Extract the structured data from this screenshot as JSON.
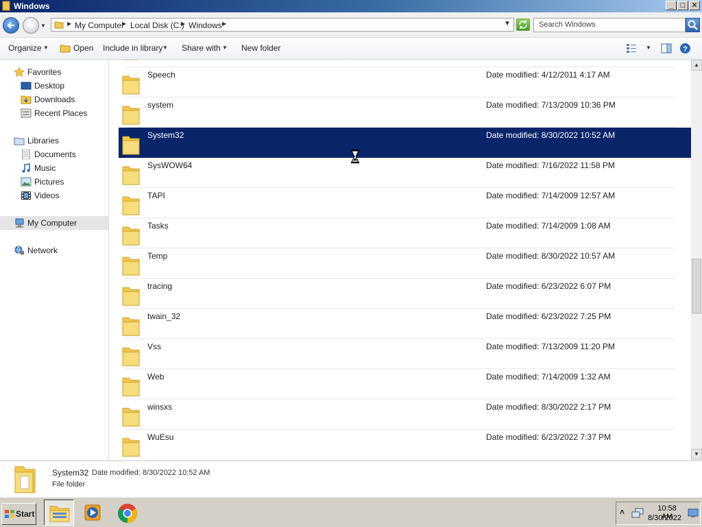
{
  "window": {
    "title": "Windows",
    "minimize": "_",
    "maximize": "□",
    "close": "✕"
  },
  "address": {
    "crumbs": [
      "My Computer",
      "Local Disk (C:)",
      "Windows"
    ],
    "search_placeholder": "Search Windows"
  },
  "toolbar": {
    "organize": "Organize",
    "open": "Open",
    "include_in_library": "Include in library",
    "share_with": "Share with",
    "new_folder": "New folder"
  },
  "sidebar": {
    "favorites": "Favorites",
    "desktop": "Desktop",
    "downloads": "Downloads",
    "recent_places": "Recent Places",
    "libraries": "Libraries",
    "documents": "Documents",
    "music": "Music",
    "pictures": "Pictures",
    "videos": "Videos",
    "my_computer": "My Computer",
    "network": "Network"
  },
  "files": [
    {
      "name": "Speech",
      "modified": "Date modified: 4/12/2011 4:17 AM"
    },
    {
      "name": "system",
      "modified": "Date modified: 7/13/2009 10:36 PM"
    },
    {
      "name": "System32",
      "modified": "Date modified: 8/30/2022 10:52 AM",
      "selected": true
    },
    {
      "name": "SysWOW64",
      "modified": "Date modified: 7/16/2022 11:58 PM"
    },
    {
      "name": "TAPI",
      "modified": "Date modified: 7/14/2009 12:57 AM"
    },
    {
      "name": "Tasks",
      "modified": "Date modified: 7/14/2009 1:08 AM"
    },
    {
      "name": "Temp",
      "modified": "Date modified: 8/30/2022 10:57 AM"
    },
    {
      "name": "tracing",
      "modified": "Date modified: 6/23/2022 6:07 PM"
    },
    {
      "name": "twain_32",
      "modified": "Date modified: 6/23/2022 7:25 PM"
    },
    {
      "name": "Vss",
      "modified": "Date modified: 7/13/2009 11:20 PM"
    },
    {
      "name": "Web",
      "modified": "Date modified: 7/14/2009 1:32 AM"
    },
    {
      "name": "winsxs",
      "modified": "Date modified: 8/30/2022 2:17 PM"
    },
    {
      "name": "WuEsu",
      "modified": "Date modified: 6/23/2022 7:37 PM"
    }
  ],
  "details": {
    "name": "System32",
    "modified_label": "Date modified: 8/30/2022 10:52 AM",
    "type": "File folder"
  },
  "taskbar": {
    "start": "Start",
    "time": "10:58 AM",
    "date": "8/30/2022",
    "tray_arrow": "˄"
  },
  "colors": {
    "selection": "#0a246a",
    "title_start": "#0a246a",
    "title_end": "#a6caf0",
    "folder": "#f2c94c"
  }
}
